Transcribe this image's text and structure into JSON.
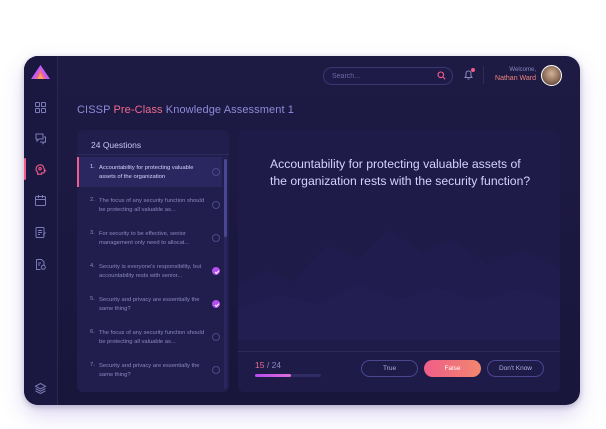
{
  "header": {
    "search_placeholder": "Search...",
    "welcome_label": "Welcome,",
    "user_name": "Nathan Ward"
  },
  "page": {
    "title_part1": "CISSP ",
    "title_part2": "Pre-Class",
    "title_part3": " Knowledge Assessment 1"
  },
  "question_list": {
    "header": "24 Questions",
    "items": [
      {
        "num": "1.",
        "text": "Accountability for protecting valuable assets of the organization",
        "status": "pending",
        "active": true
      },
      {
        "num": "2.",
        "text": "The focus of any security function should be protecting all valuable as...",
        "status": "pending",
        "active": false
      },
      {
        "num": "3.",
        "text": "For security to be effective, senior management only need to allocat...",
        "status": "pending",
        "active": false
      },
      {
        "num": "4.",
        "text": "Security is everyone's responsibility, but accountability rests with senior...",
        "status": "done",
        "active": false
      },
      {
        "num": "5.",
        "text": "Security and privacy are essentially the same thing?",
        "status": "done",
        "active": false
      },
      {
        "num": "6.",
        "text": "The focus of any security function should be protecting all valuable as...",
        "status": "pending",
        "active": false
      },
      {
        "num": "7.",
        "text": "Security and privacy are essentially the same thing?",
        "status": "pending",
        "active": false
      }
    ]
  },
  "question": {
    "text": "Accountability for protecting valuable assets of the organization rests with the security function?"
  },
  "progress": {
    "current": "15",
    "total": "/ 24",
    "fraction": 0.55
  },
  "answers": {
    "true_label": "True",
    "false_label": "False",
    "dont_know_label": "Don't Know"
  },
  "colors": {
    "accent_pink": "#ef5d88",
    "accent_purple": "#b44ef0",
    "panel_bg": "#211e4d",
    "app_bg": "#1d1a44"
  },
  "icons": {
    "sidebar": [
      "dashboard-icon",
      "chat-icon",
      "brain-icon",
      "calendar-icon",
      "notes-icon",
      "report-icon",
      "layers-icon"
    ],
    "top": [
      "search-icon",
      "bell-icon"
    ]
  }
}
